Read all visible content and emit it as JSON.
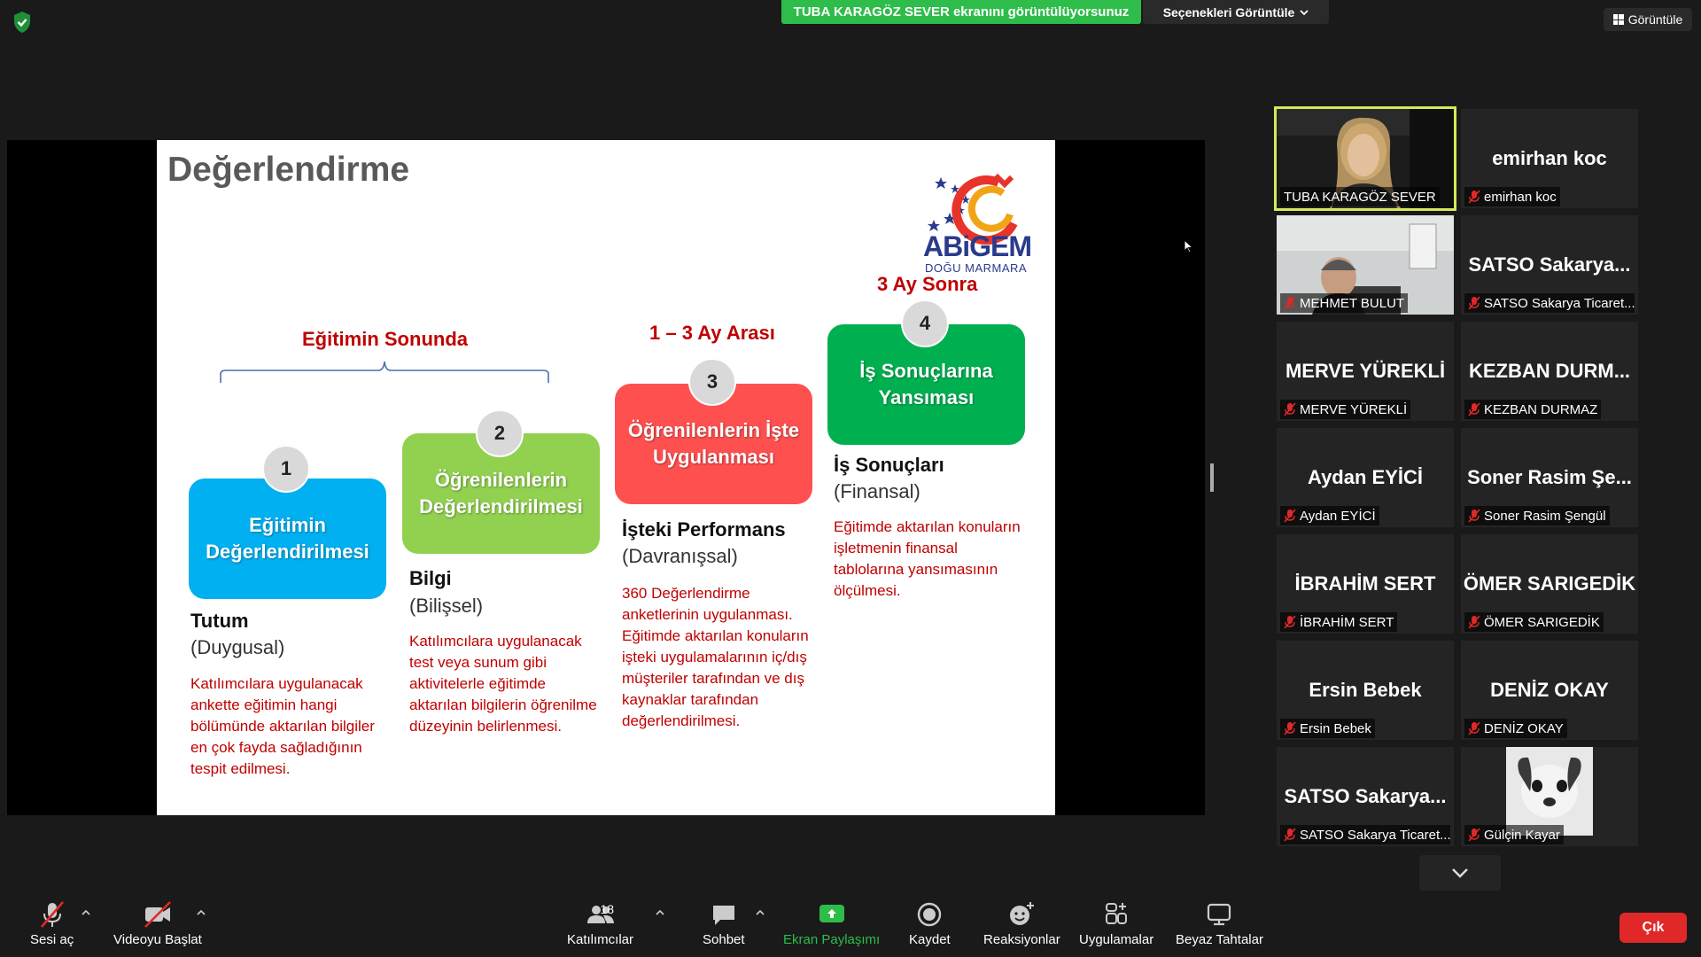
{
  "banner": {
    "sharing_text": "TUBA KARAGÖZ SEVER ekranını görüntülüyorsunuz",
    "view_options": "Seçenekleri Görüntüle",
    "view_button": "Görüntüle"
  },
  "slide": {
    "title": "Değerlendirme",
    "logo_text": "ABiGEM",
    "logo_sub": "DOĞU MARMARA",
    "head_end_of_training": "Eğitimin Sonunda",
    "head_1_3_months": "1 – 3  Ay Arası",
    "head_3_months": "3 Ay Sonra",
    "levels": [
      {
        "num": "1",
        "box": "Eğitimin Değerlendirilmesi",
        "title": "Tutum",
        "subtitle": "(Duygusal)",
        "desc": "Katılımcılara uygulanacak ankette eğitimin hangi bölümünde aktarılan bilgiler en çok fayda sağladığının tespit edilmesi."
      },
      {
        "num": "2",
        "box": "Öğrenilenlerin Değerlendirilmesi",
        "title": "Bilgi",
        "subtitle": "(Bilişsel)",
        "desc": "Katılımcılara uygulanacak test veya sunum gibi aktivitelerle eğitimde aktarılan bilgilerin öğrenilme düzeyinin belirlenmesi."
      },
      {
        "num": "3",
        "box": "Öğrenilenlerin İşte Uygulanması",
        "title": "İşteki Performans",
        "subtitle": "(Davranışsal)",
        "desc": "360 Değerlendirme anketlerinin uygulanması. Eğitimde aktarılan konuların işteki uygulamalarının iç/dış müşteriler tarafından ve dış kaynaklar tarafından değerlendirilmesi."
      },
      {
        "num": "4",
        "box": "İş Sonuçlarına Yansıması",
        "title": "İş Sonuçları",
        "subtitle": "(Finansal)",
        "desc": "Eğitimde aktarılan konuların işletmenin finansal tablolarına yansımasının ölçülmesi."
      }
    ]
  },
  "participants": [
    {
      "big": "",
      "name": "TUBA KARAGÖZ SEVER",
      "video": true,
      "muted": false
    },
    {
      "big": "emirhan koc",
      "name": "emirhan koc",
      "video": false,
      "muted": true
    },
    {
      "big": "",
      "name": "MEHMET BULUT",
      "video": true,
      "muted": true
    },
    {
      "big": "SATSO  Sakarya...",
      "name": "SATSO Sakarya Ticaret...",
      "video": false,
      "muted": true
    },
    {
      "big": "MERVE YÜREKLİ",
      "name": "MERVE YÜREKLİ",
      "video": false,
      "muted": true
    },
    {
      "big": "KEZBAN  DURM...",
      "name": "KEZBAN DURMAZ",
      "video": false,
      "muted": true
    },
    {
      "big": "Aydan EYİCİ",
      "name": "Aydan EYİCİ",
      "video": false,
      "muted": true
    },
    {
      "big": "Soner Rasim Şe...",
      "name": "Soner Rasim Şengül",
      "video": false,
      "muted": true
    },
    {
      "big": "İBRAHİM SERT",
      "name": "İBRAHİM SERT",
      "video": false,
      "muted": true
    },
    {
      "big": "ÖMER SARIGEDİK",
      "name": "ÖMER SARIGEDİK",
      "video": false,
      "muted": true
    },
    {
      "big": "Ersin Bebek",
      "name": "Ersin Bebek",
      "video": false,
      "muted": true
    },
    {
      "big": "DENİZ OKAY",
      "name": "DENİZ OKAY",
      "video": false,
      "muted": true
    },
    {
      "big": "SATSO  Sakarya...",
      "name": "SATSO Sakarya Ticaret...",
      "video": false,
      "muted": true
    },
    {
      "big": "",
      "name": "Gülçin Kayar",
      "video": true,
      "muted": true
    }
  ],
  "toolbar": {
    "unmute": "Sesi aç",
    "start_video": "Videoyu Başlat",
    "participants": "Katılımcılar",
    "participant_count": "18",
    "chat": "Sohbet",
    "share_screen": "Ekran Paylaşımı",
    "record": "Kaydet",
    "reactions": "Reaksiyonlar",
    "apps": "Uygulamalar",
    "whiteboards": "Beyaz Tahtalar",
    "leave": "Çık"
  },
  "colors": {
    "accent_green": "#2ebd4b",
    "active_speaker": "#d7e85b",
    "leave_red": "#e02828",
    "slide_red": "#c00000"
  }
}
